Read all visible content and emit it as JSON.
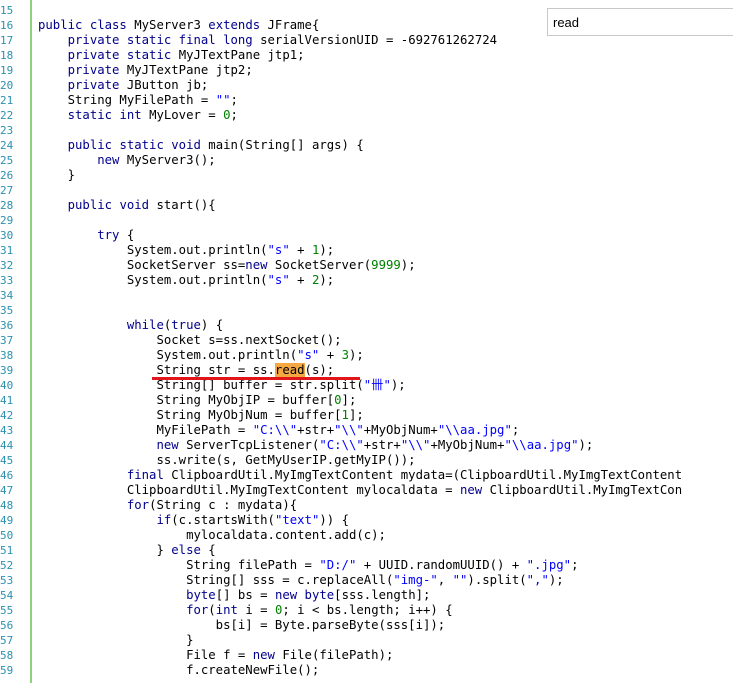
{
  "editor": {
    "lines": [
      {
        "n": "15",
        "tokens": [
          {
            "t": ""
          }
        ]
      },
      {
        "n": "16",
        "tokens": [
          {
            "t": "public class ",
            "c": "kw"
          },
          {
            "t": "MyServer3 "
          },
          {
            "t": "extends ",
            "c": "kw"
          },
          {
            "t": "JFrame{"
          }
        ]
      },
      {
        "n": "17",
        "tokens": [
          {
            "t": "    "
          },
          {
            "t": "private static final long ",
            "c": "kw"
          },
          {
            "t": "serialVersionUID = -692761262724"
          }
        ]
      },
      {
        "n": "18",
        "tokens": [
          {
            "t": "    "
          },
          {
            "t": "private static ",
            "c": "kw"
          },
          {
            "t": "MyJTextPane jtp1;"
          }
        ]
      },
      {
        "n": "19",
        "tokens": [
          {
            "t": "    "
          },
          {
            "t": "private ",
            "c": "kw"
          },
          {
            "t": "MyJTextPane jtp2;"
          }
        ]
      },
      {
        "n": "20",
        "tokens": [
          {
            "t": "    "
          },
          {
            "t": "private ",
            "c": "kw"
          },
          {
            "t": "JButton jb;"
          }
        ]
      },
      {
        "n": "21",
        "tokens": [
          {
            "t": "    String MyFilePath = "
          },
          {
            "t": "\"\"",
            "c": "str"
          },
          {
            "t": ";"
          }
        ]
      },
      {
        "n": "22",
        "tokens": [
          {
            "t": "    "
          },
          {
            "t": "static int ",
            "c": "kw"
          },
          {
            "t": "MyLover = "
          },
          {
            "t": "0",
            "c": "num"
          },
          {
            "t": ";"
          }
        ]
      },
      {
        "n": "23",
        "tokens": [
          {
            "t": ""
          }
        ]
      },
      {
        "n": "24",
        "tokens": [
          {
            "t": "    "
          },
          {
            "t": "public static void ",
            "c": "kw"
          },
          {
            "t": "main(String[] args) {"
          }
        ]
      },
      {
        "n": "25",
        "tokens": [
          {
            "t": "        "
          },
          {
            "t": "new ",
            "c": "kw"
          },
          {
            "t": "MyServer3();"
          }
        ]
      },
      {
        "n": "26",
        "tokens": [
          {
            "t": "    }"
          }
        ]
      },
      {
        "n": "27",
        "tokens": [
          {
            "t": ""
          }
        ]
      },
      {
        "n": "28",
        "tokens": [
          {
            "t": "    "
          },
          {
            "t": "public void ",
            "c": "kw"
          },
          {
            "t": "start(){"
          }
        ]
      },
      {
        "n": "29",
        "tokens": [
          {
            "t": ""
          }
        ]
      },
      {
        "n": "30",
        "tokens": [
          {
            "t": "        "
          },
          {
            "t": "try ",
            "c": "kw"
          },
          {
            "t": "{"
          }
        ]
      },
      {
        "n": "31",
        "tokens": [
          {
            "t": "            System.out.println("
          },
          {
            "t": "\"s\"",
            "c": "str"
          },
          {
            "t": " + "
          },
          {
            "t": "1",
            "c": "num"
          },
          {
            "t": ");"
          }
        ]
      },
      {
        "n": "32",
        "tokens": [
          {
            "t": "            SocketServer ss="
          },
          {
            "t": "new ",
            "c": "kw"
          },
          {
            "t": "SocketServer("
          },
          {
            "t": "9999",
            "c": "num"
          },
          {
            "t": ");"
          }
        ]
      },
      {
        "n": "33",
        "tokens": [
          {
            "t": "            System.out.println("
          },
          {
            "t": "\"s\"",
            "c": "str"
          },
          {
            "t": " + "
          },
          {
            "t": "2",
            "c": "num"
          },
          {
            "t": ");"
          }
        ]
      },
      {
        "n": "34",
        "tokens": [
          {
            "t": ""
          }
        ]
      },
      {
        "n": "35",
        "tokens": [
          {
            "t": ""
          }
        ]
      },
      {
        "n": "36",
        "tokens": [
          {
            "t": "            "
          },
          {
            "t": "while",
            "c": "kw"
          },
          {
            "t": "("
          },
          {
            "t": "true",
            "c": "kw"
          },
          {
            "t": ") {"
          }
        ]
      },
      {
        "n": "37",
        "tokens": [
          {
            "t": "                Socket s=ss.nextSocket();"
          }
        ]
      },
      {
        "n": "38",
        "tokens": [
          {
            "t": "                System.out.println("
          },
          {
            "t": "\"s\"",
            "c": "str"
          },
          {
            "t": " + "
          },
          {
            "t": "3",
            "c": "num"
          },
          {
            "t": ");"
          }
        ]
      },
      {
        "n": "39",
        "tokens": [
          {
            "t": "                String str = ss."
          },
          {
            "t": "read",
            "c": "hl"
          },
          {
            "t": "(s);"
          }
        ]
      },
      {
        "n": "40",
        "tokens": [
          {
            "t": "                String[] buffer = str.split("
          },
          {
            "t": "\"卌\"",
            "c": "str"
          },
          {
            "t": ");"
          }
        ]
      },
      {
        "n": "41",
        "tokens": [
          {
            "t": "                String MyObjIP = buffer["
          },
          {
            "t": "0",
            "c": "num"
          },
          {
            "t": "];"
          }
        ]
      },
      {
        "n": "42",
        "tokens": [
          {
            "t": "                String MyObjNum = buffer["
          },
          {
            "t": "1",
            "c": "num"
          },
          {
            "t": "];"
          }
        ]
      },
      {
        "n": "43",
        "tokens": [
          {
            "t": "                MyFilePath = "
          },
          {
            "t": "\"C:\\\\\"",
            "c": "str"
          },
          {
            "t": "+str+"
          },
          {
            "t": "\"\\\\\"",
            "c": "str"
          },
          {
            "t": "+MyObjNum+"
          },
          {
            "t": "\"\\\\aa.jpg\"",
            "c": "str"
          },
          {
            "t": ";"
          }
        ]
      },
      {
        "n": "44",
        "tokens": [
          {
            "t": "                "
          },
          {
            "t": "new ",
            "c": "kw"
          },
          {
            "t": "ServerTcpListener("
          },
          {
            "t": "\"C:\\\\\"",
            "c": "str"
          },
          {
            "t": "+str+"
          },
          {
            "t": "\"\\\\\"",
            "c": "str"
          },
          {
            "t": "+MyObjNum+"
          },
          {
            "t": "\"\\\\aa.jpg\"",
            "c": "str"
          },
          {
            "t": ");"
          }
        ]
      },
      {
        "n": "45",
        "tokens": [
          {
            "t": "                ss.write(s, GetMyUserIP.getMyIP());"
          }
        ]
      },
      {
        "n": "46",
        "tokens": [
          {
            "t": "            "
          },
          {
            "t": "final ",
            "c": "kw"
          },
          {
            "t": "ClipboardUtil.MyImgTextContent mydata=(ClipboardUtil.MyImgTextContent"
          }
        ]
      },
      {
        "n": "47",
        "tokens": [
          {
            "t": "            ClipboardUtil.MyImgTextContent mylocaldata = "
          },
          {
            "t": "new ",
            "c": "kw"
          },
          {
            "t": "ClipboardUtil.MyImgTextCon"
          }
        ]
      },
      {
        "n": "48",
        "tokens": [
          {
            "t": "            "
          },
          {
            "t": "for",
            "c": "kw"
          },
          {
            "t": "(String c : mydata){"
          }
        ]
      },
      {
        "n": "49",
        "tokens": [
          {
            "t": "                "
          },
          {
            "t": "if",
            "c": "kw"
          },
          {
            "t": "(c.startsWith("
          },
          {
            "t": "\"text\"",
            "c": "str"
          },
          {
            "t": ")) {"
          }
        ]
      },
      {
        "n": "50",
        "tokens": [
          {
            "t": "                    mylocaldata.content.add(c);"
          }
        ]
      },
      {
        "n": "51",
        "tokens": [
          {
            "t": "                } "
          },
          {
            "t": "else ",
            "c": "kw"
          },
          {
            "t": "{"
          }
        ]
      },
      {
        "n": "52",
        "tokens": [
          {
            "t": "                    String filePath = "
          },
          {
            "t": "\"D:/\"",
            "c": "str"
          },
          {
            "t": " + UUID.randomUUID() + "
          },
          {
            "t": "\".jpg\"",
            "c": "str"
          },
          {
            "t": ";"
          }
        ]
      },
      {
        "n": "53",
        "tokens": [
          {
            "t": "                    String[] sss = c.replaceAll("
          },
          {
            "t": "\"img-\"",
            "c": "str"
          },
          {
            "t": ", "
          },
          {
            "t": "\"\"",
            "c": "str"
          },
          {
            "t": ").split("
          },
          {
            "t": "\",\"",
            "c": "str"
          },
          {
            "t": ");"
          }
        ]
      },
      {
        "n": "54",
        "tokens": [
          {
            "t": "                    "
          },
          {
            "t": "byte",
            "c": "kw"
          },
          {
            "t": "[] bs = "
          },
          {
            "t": "new byte",
            "c": "kw"
          },
          {
            "t": "[sss.length];"
          }
        ]
      },
      {
        "n": "55",
        "tokens": [
          {
            "t": "                    "
          },
          {
            "t": "for",
            "c": "kw"
          },
          {
            "t": "("
          },
          {
            "t": "int ",
            "c": "kw"
          },
          {
            "t": "i = "
          },
          {
            "t": "0",
            "c": "num"
          },
          {
            "t": "; i < bs.length; i++) {"
          }
        ]
      },
      {
        "n": "56",
        "tokens": [
          {
            "t": "                        bs[i] = Byte.parseByte(sss[i]);"
          }
        ]
      },
      {
        "n": "57",
        "tokens": [
          {
            "t": "                    }"
          }
        ]
      },
      {
        "n": "58",
        "tokens": [
          {
            "t": "                    File f = "
          },
          {
            "t": "new ",
            "c": "kw"
          },
          {
            "t": "File(filePath);"
          }
        ]
      },
      {
        "n": "59",
        "tokens": [
          {
            "t": "                    f.createNewFile();"
          }
        ]
      }
    ]
  },
  "search": {
    "value": "read"
  },
  "colors": {
    "keyword": "#00008b",
    "string": "#0000ff",
    "number": "#008000",
    "line_number": "#2b91af",
    "highlight": "#f5a742",
    "underline": "#e0161b",
    "gutter_bar": "#8fd07a"
  }
}
